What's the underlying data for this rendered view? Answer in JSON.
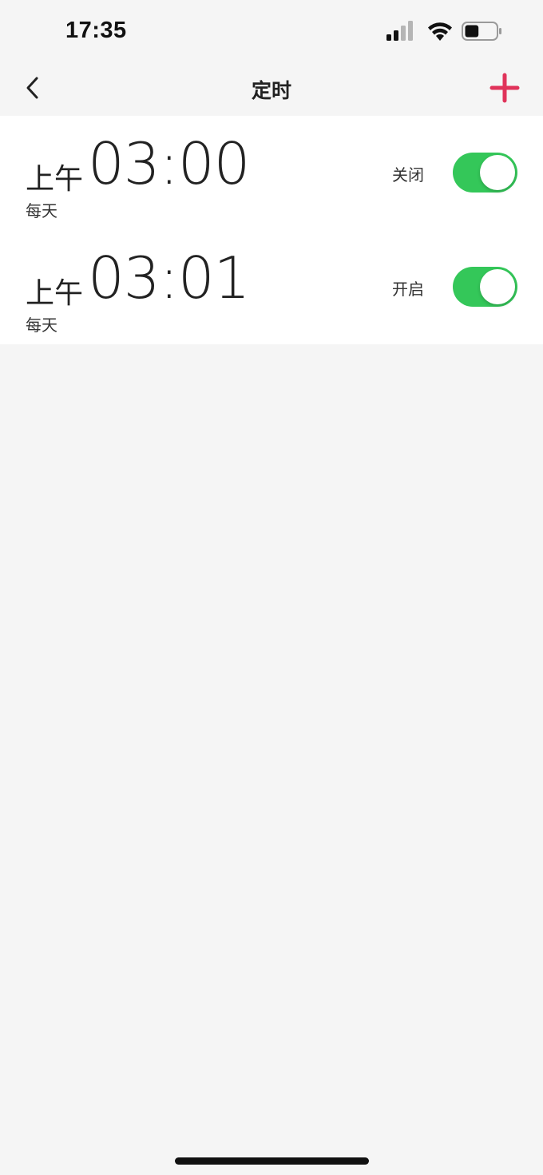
{
  "status_bar": {
    "time": "17:35",
    "icons": [
      "cellular-signal-icon",
      "wifi-icon",
      "battery-icon"
    ],
    "battery_level": 0.45
  },
  "nav": {
    "title": "定时",
    "back_icon": "chevron-left-icon",
    "add_icon": "plus-icon",
    "accent_color": "#e0335a"
  },
  "timers": [
    {
      "period": "上午",
      "time": "03:00",
      "repeat": "每天",
      "status_label": "关闭",
      "enabled": true
    },
    {
      "period": "上午",
      "time": "03:01",
      "repeat": "每天",
      "status_label": "开启",
      "enabled": true
    }
  ],
  "colors": {
    "toggle_on": "#34c759",
    "background": "#f5f5f5",
    "list_background": "#ffffff"
  }
}
